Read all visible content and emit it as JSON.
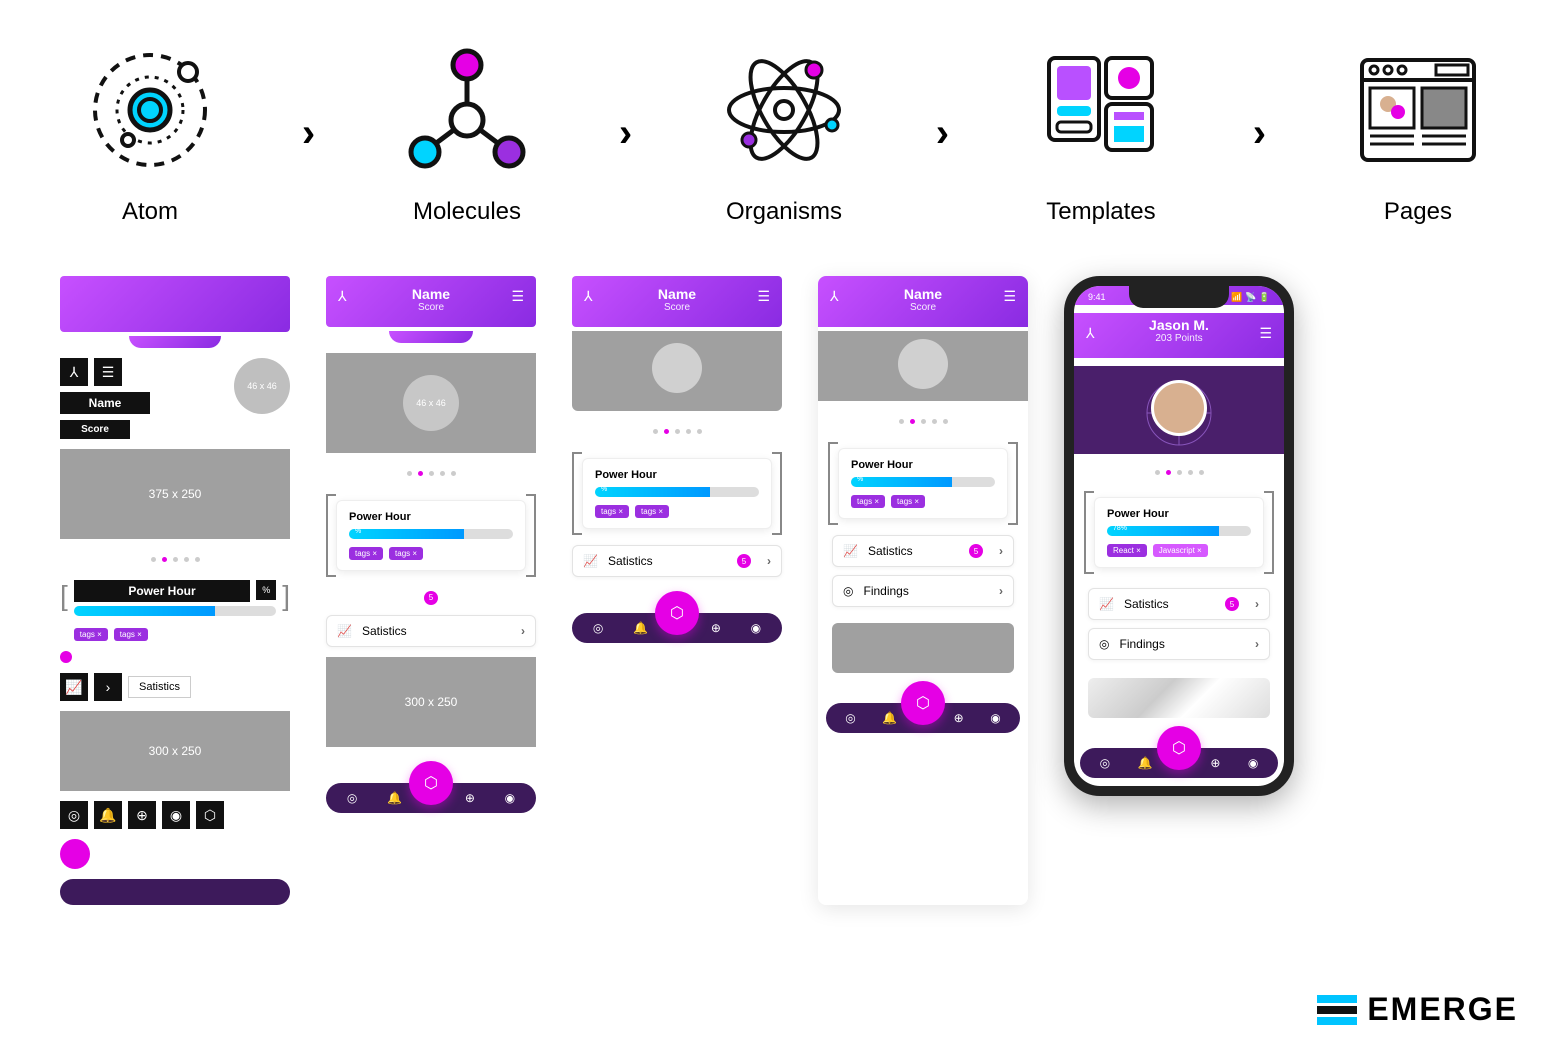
{
  "stages": [
    "Atom",
    "Molecules",
    "Organisms",
    "Templates",
    "Pages"
  ],
  "common": {
    "name": "Name",
    "score": "Score",
    "power": "Power Hour",
    "pct": "%",
    "tag": "tags ×",
    "stats": "Satistics",
    "findings": "Findings",
    "badge": "5"
  },
  "atom": {
    "placeholder46": "46 x 46",
    "placeholder375": "375 x 250",
    "placeholder300": "300 x 250"
  },
  "molecules": {
    "placeholder300": "300 x 250"
  },
  "page": {
    "time": "9:41",
    "user": "Jason M.",
    "points": "203 Points",
    "pct": "78%",
    "tag1": "React ×",
    "tag2": "Javascript ×"
  },
  "brand": "EMERGE"
}
